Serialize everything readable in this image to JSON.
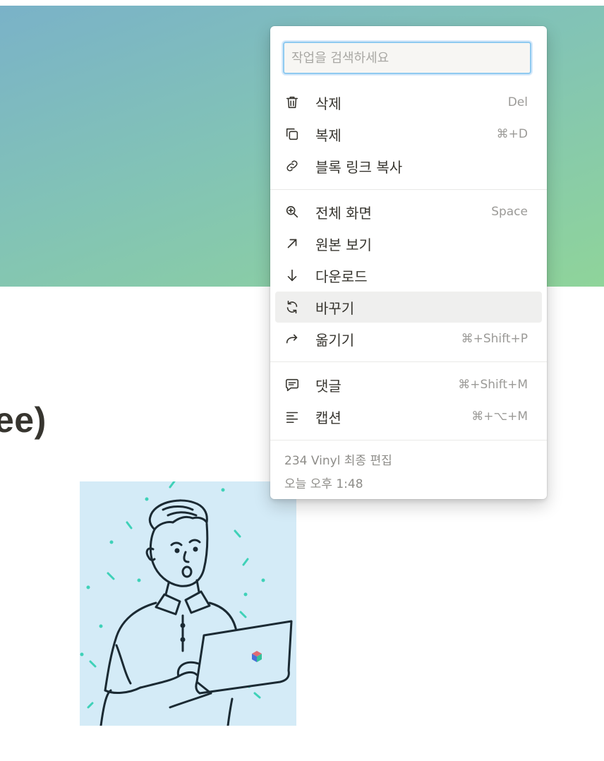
{
  "page": {
    "title": "ee)"
  },
  "menu": {
    "search_placeholder": "작업을 검색하세요",
    "groups": [
      [
        {
          "icon": "trash-icon",
          "label": "삭제",
          "shortcut": "Del"
        },
        {
          "icon": "copy-icon",
          "label": "복제",
          "shortcut": "⌘+D"
        },
        {
          "icon": "link-icon",
          "label": "블록 링크 복사",
          "shortcut": ""
        }
      ],
      [
        {
          "icon": "zoom-in-icon",
          "label": "전체 화면",
          "shortcut": "Space"
        },
        {
          "icon": "arrow-up-right-icon",
          "label": "원본 보기",
          "shortcut": ""
        },
        {
          "icon": "arrow-down-icon",
          "label": "다운로드",
          "shortcut": ""
        },
        {
          "icon": "refresh-icon",
          "label": "바꾸기",
          "shortcut": "",
          "active": true
        },
        {
          "icon": "move-arrow-icon",
          "label": "옮기기",
          "shortcut": "⌘+Shift+P"
        }
      ],
      [
        {
          "icon": "comment-icon",
          "label": "댓글",
          "shortcut": "⌘+Shift+M"
        },
        {
          "icon": "caption-icon",
          "label": "캡션",
          "shortcut": "⌘+⌥+M"
        }
      ]
    ],
    "footer": {
      "edited_by": "234 Vinyl 최종 편집",
      "edited_time": "오늘 오후 1:48"
    }
  },
  "colors": {
    "cover_start": "#7ab2c8",
    "cover_end": "#8fd49a",
    "illustration_bg": "#d4ebf7",
    "active_row": "#efefee"
  }
}
